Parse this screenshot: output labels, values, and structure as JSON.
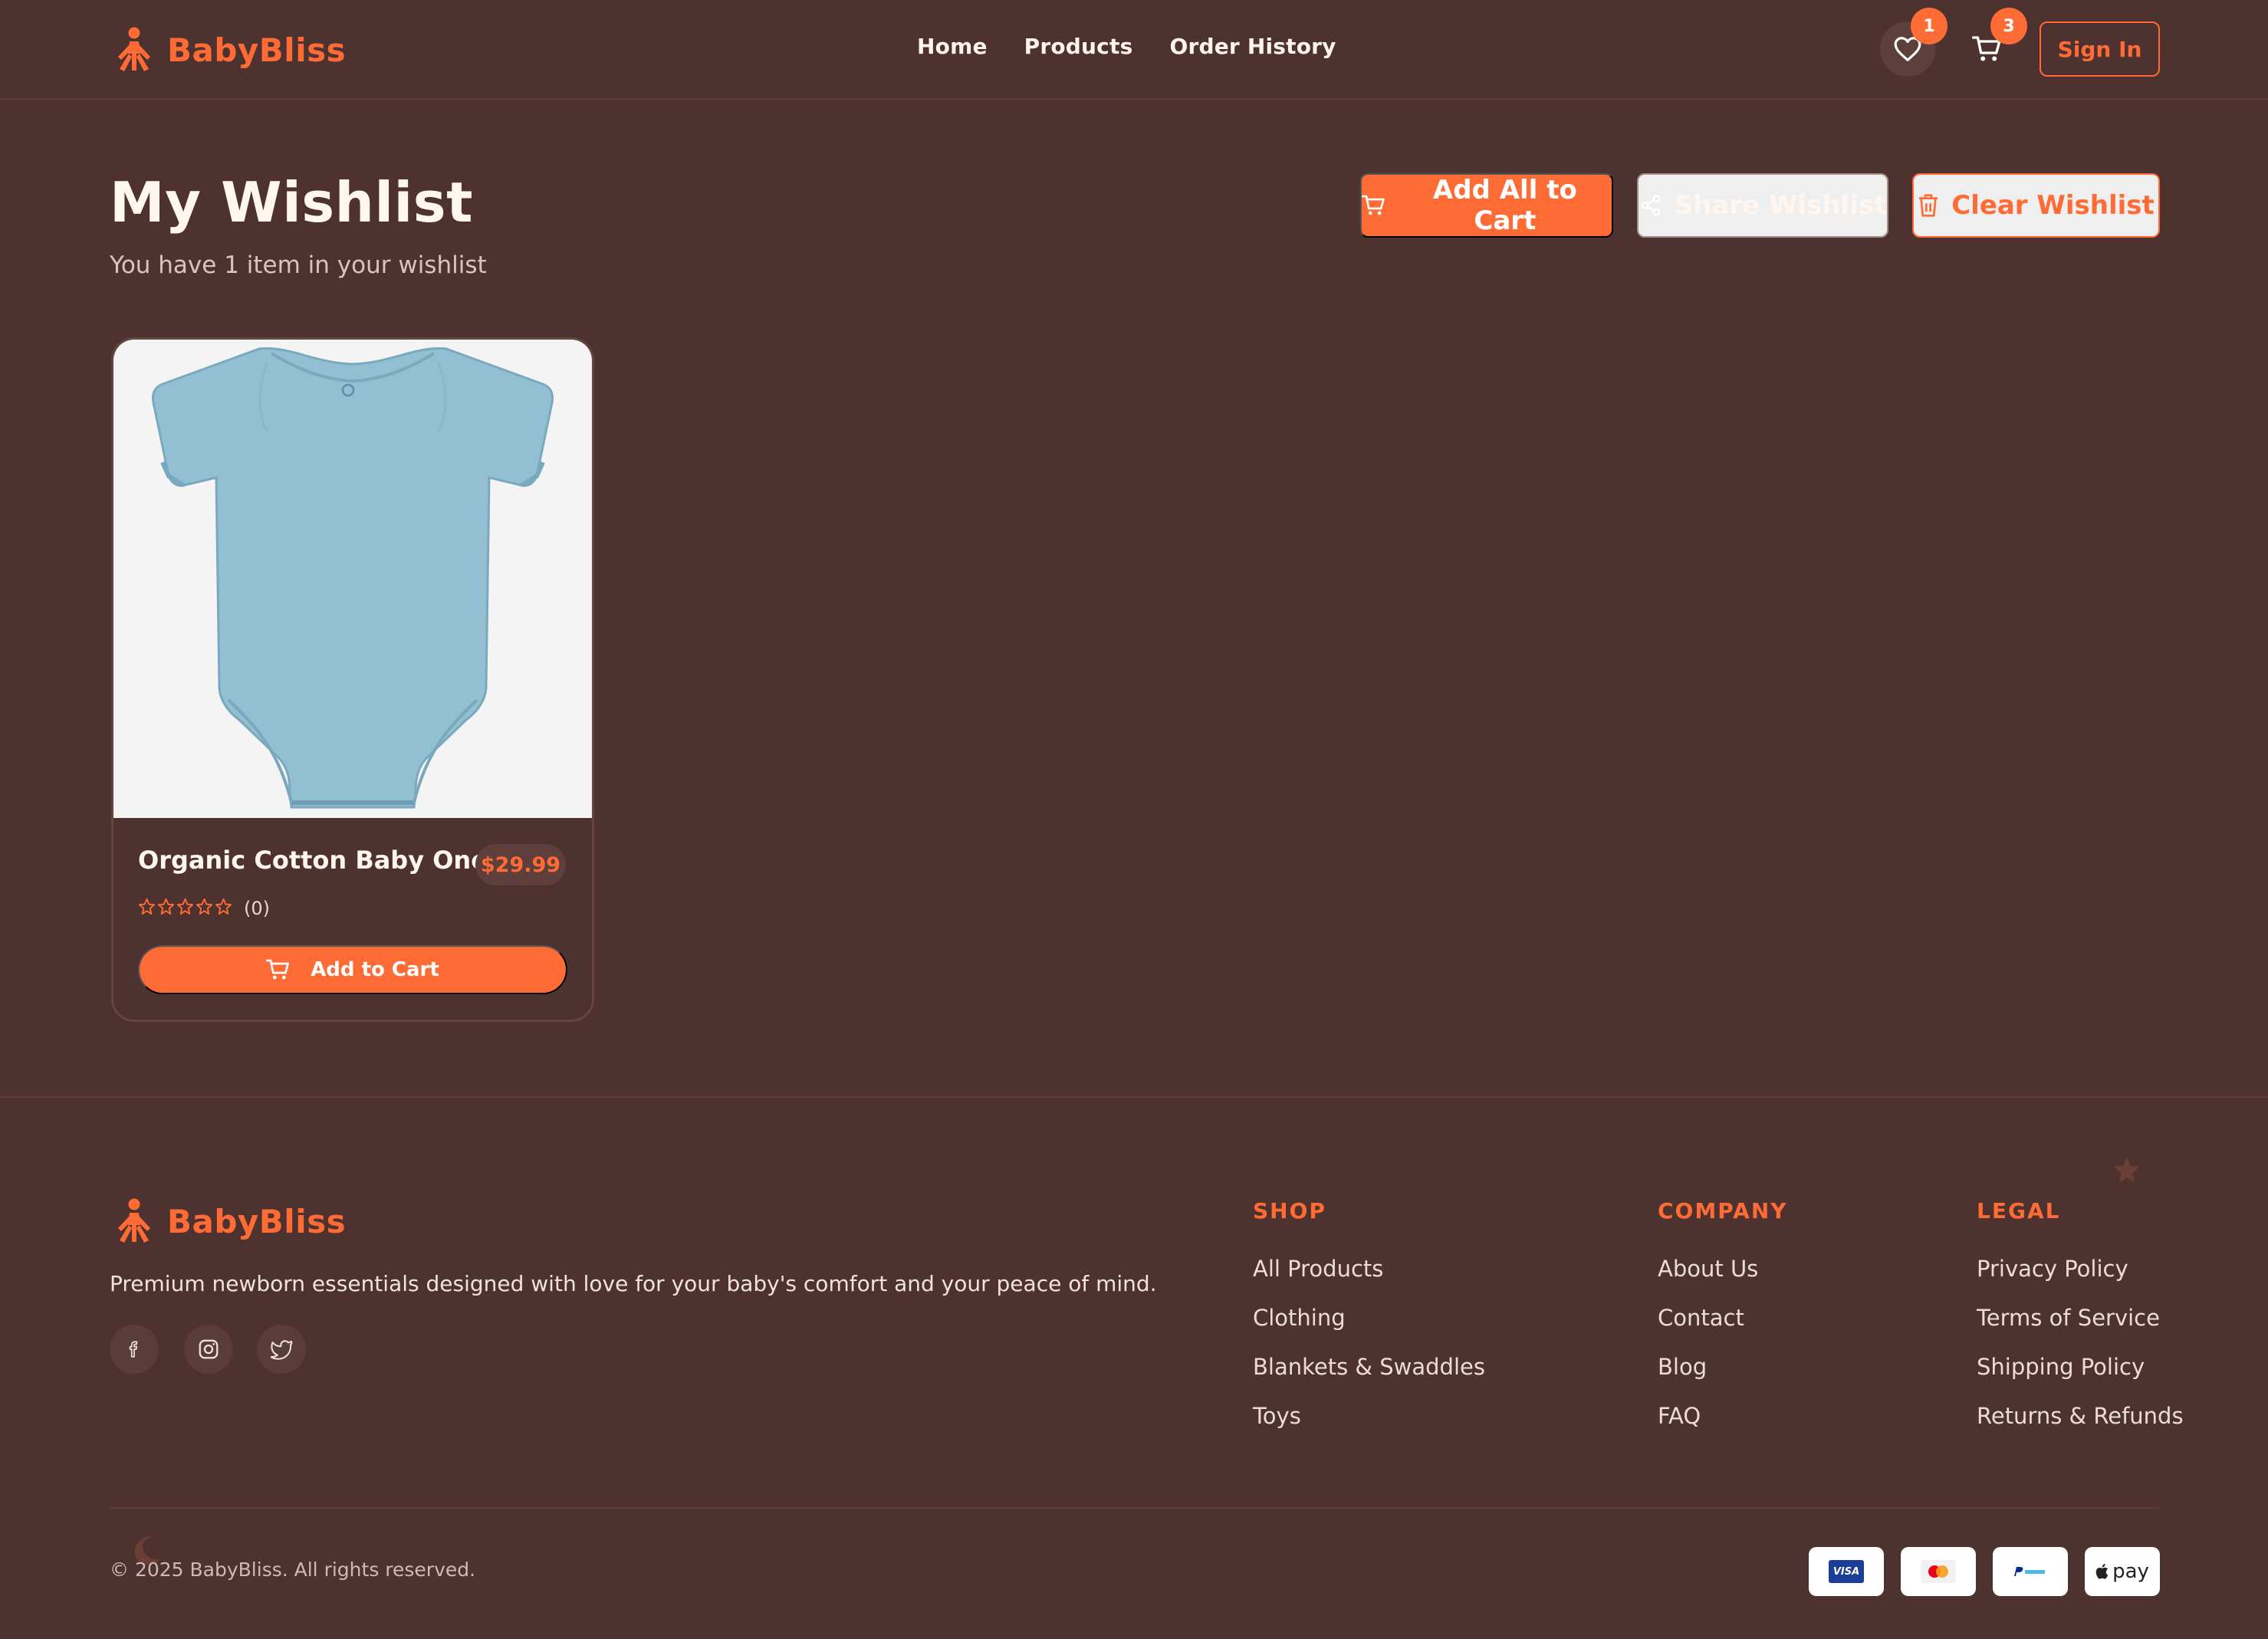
{
  "brand": {
    "name": "BabyBliss",
    "accent": "#ff6b35",
    "background": "#4e3230"
  },
  "nav": {
    "items": [
      "Home",
      "Products",
      "Order History"
    ]
  },
  "header": {
    "wishlist_count": "1",
    "cart_count": "3",
    "sign_in_label": "Sign In",
    "wishlist_icon": "heart-icon",
    "cart_icon": "cart-icon"
  },
  "wishlist": {
    "title": "My Wishlist",
    "subtitle": "You have 1 item in your wishlist",
    "actions": {
      "add_all": "Add All to Cart",
      "share": "Share Wishlist",
      "clear": "Clear Wishlist"
    },
    "items": [
      {
        "name": "Organic Cotton Baby Onesie",
        "price": "$29.99",
        "rating": 0,
        "rating_count": "(0)",
        "button": "Add to Cart",
        "image": "light-blue-baby-onesie"
      }
    ]
  },
  "footer": {
    "description": "Premium newborn essentials designed with love for your baby's comfort and your peace of mind.",
    "social": [
      "facebook-icon",
      "instagram-icon",
      "twitter-icon"
    ],
    "columns": [
      {
        "heading": "SHOP",
        "links": [
          "All Products",
          "Clothing",
          "Blankets & Swaddles",
          "Toys"
        ]
      },
      {
        "heading": "COMPANY",
        "links": [
          "About Us",
          "Contact",
          "Blog",
          "FAQ"
        ]
      },
      {
        "heading": "LEGAL",
        "links": [
          "Privacy Policy",
          "Terms of Service",
          "Shipping Policy",
          "Returns & Refunds"
        ]
      }
    ],
    "copyright": "© 2025 BabyBliss. All rights reserved.",
    "payment_methods": [
      "VISA",
      "Mastercard",
      "PayPal",
      "pay"
    ]
  }
}
